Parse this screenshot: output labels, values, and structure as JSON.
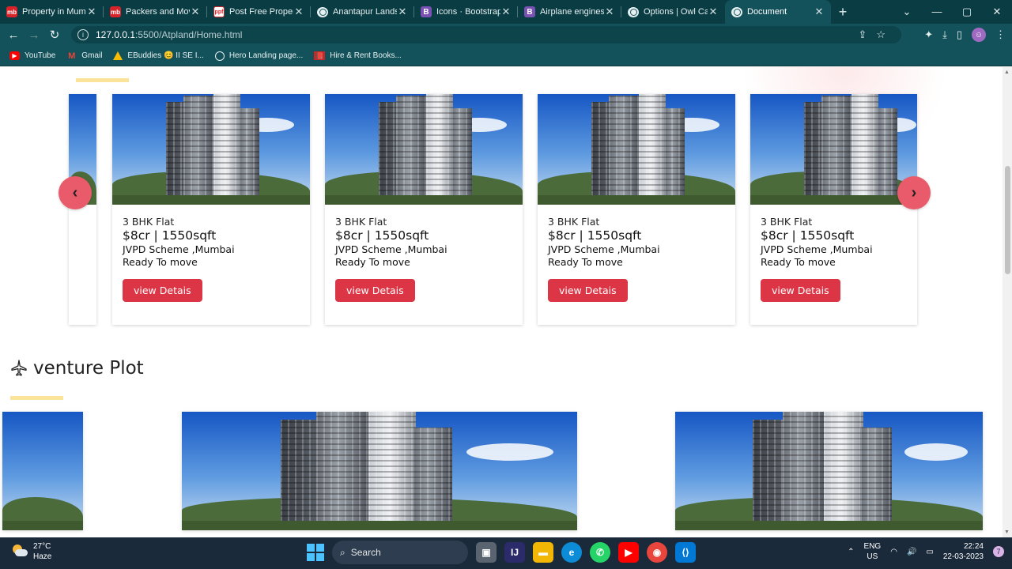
{
  "browser": {
    "tabs": [
      {
        "title": "Property in Mumb",
        "icon": "mb"
      },
      {
        "title": "Packers and Move",
        "icon": "mb"
      },
      {
        "title": "Post Free Propert",
        "icon": "ppf"
      },
      {
        "title": "Anantapur Lands",
        "icon": "globe"
      },
      {
        "title": "Icons · Bootstrap",
        "icon": "B"
      },
      {
        "title": "Airplane engines",
        "icon": "B"
      },
      {
        "title": "Options | Owl Car",
        "icon": "globe"
      },
      {
        "title": "Document",
        "icon": "globe",
        "active": true
      }
    ],
    "url_host": "127.0.0.1",
    "url_path": ":5500/Atpland/Home.html",
    "bookmarks": [
      {
        "label": "YouTube",
        "icon": "youtube-icon"
      },
      {
        "label": "Gmail",
        "icon": "gmail-icon"
      },
      {
        "label": "EBuddies 😊 II SE I...",
        "icon": "drive-icon"
      },
      {
        "label": "Hero Landing page...",
        "icon": "globe-icon"
      },
      {
        "label": "Hire & Rent Books...",
        "icon": "book-icon"
      }
    ]
  },
  "listings": [
    {
      "type": "3 BHK Flat",
      "price": "$8cr | 1550sqft",
      "location": "JVPD Scheme ,Mumbai",
      "status": "Ready To move",
      "button": "view Detais"
    },
    {
      "type": "3 BHK Flat",
      "price": "$8cr | 1550sqft",
      "location": "JVPD Scheme ,Mumbai",
      "status": "Ready To move",
      "button": "view Detais"
    },
    {
      "type": "3 BHK Flat",
      "price": "$8cr | 1550sqft",
      "location": "JVPD Scheme ,Mumbai",
      "status": "Ready To move",
      "button": "view Detais"
    },
    {
      "type": "3 BHK Flat",
      "price": "$8cr | 1550sqft",
      "location": "JVPD Scheme ,Mumbai",
      "status": "Ready To move",
      "button": "view Detais"
    }
  ],
  "carousel": {
    "prev": "‹",
    "next": "›"
  },
  "section2": {
    "title": "venture Plot"
  },
  "taskbar": {
    "temp": "27°C",
    "weather": "Haze",
    "search": "Search",
    "lang1": "ENG",
    "lang2": "US",
    "time": "22:24",
    "date": "22-03-2023",
    "notifications": "7"
  },
  "colors": {
    "accent": "#dc3545",
    "arrow": "#e95a6a",
    "underline": "#fbe39a",
    "chrome": "#14525b"
  }
}
